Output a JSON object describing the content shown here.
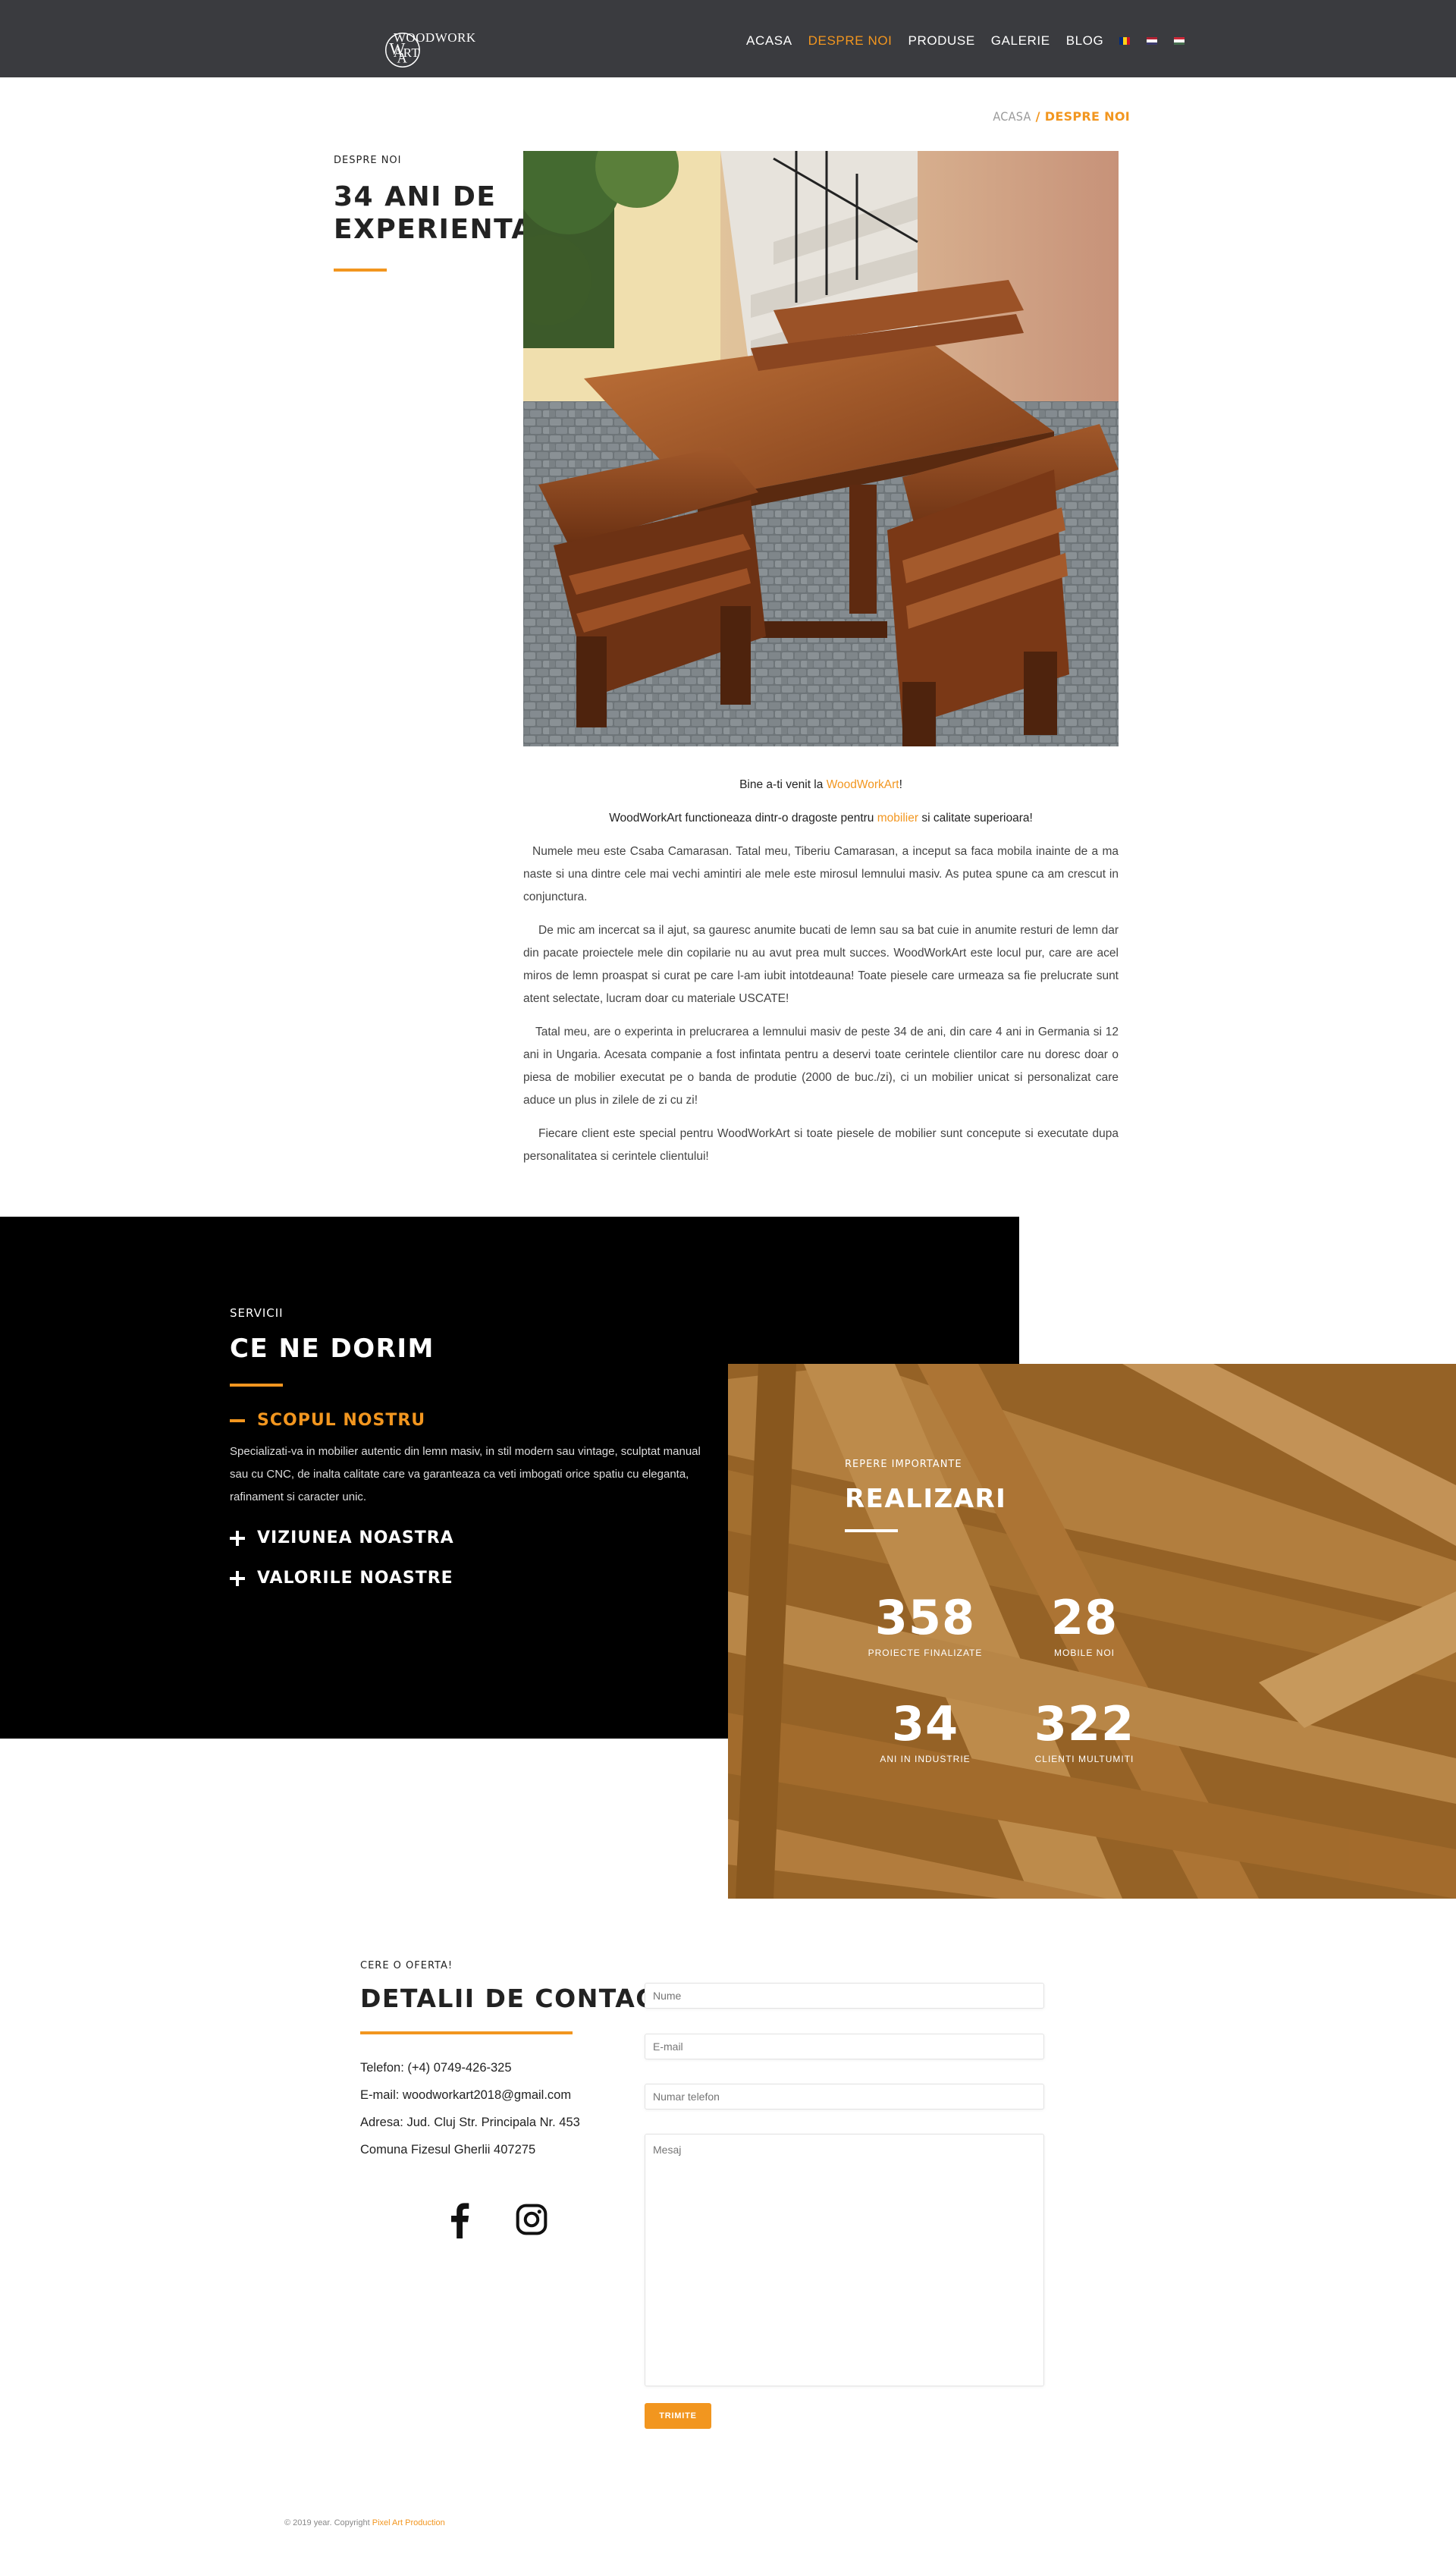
{
  "header": {
    "logo_text": "WOODWORK ART",
    "nav": [
      {
        "label": "ACASA",
        "active": false
      },
      {
        "label": "DESPRE NOI",
        "active": true
      },
      {
        "label": "PRODUSE",
        "active": false
      },
      {
        "label": "GALERIE",
        "active": false
      },
      {
        "label": "BLOG",
        "active": false
      }
    ],
    "languages": [
      "ro-flag",
      "en-flag",
      "hu-flag"
    ]
  },
  "breadcrumb": {
    "home": "ACASA",
    "separator": "/",
    "current": "DESPRE NOI"
  },
  "about": {
    "eyebrow": "DESPRE NOI",
    "title": "34 ANI DE EXPERIENTA",
    "photo_icon": "wooden-table-bench-photo",
    "welcome_pre": "Bine a-ti venit la ",
    "welcome_brand": "WoodWorkArt",
    "welcome_post": "!",
    "tagline_pre": "WoodWorkArt functioneaza dintr-o dragoste pentru ",
    "tagline_link": "mobilier",
    "tagline_post": " si calitate superioara!",
    "paragraphs": [
      "Numele meu este Csaba Camarasan. Tatal meu, Tiberiu Camarasan, a inceput sa faca mobila inainte de a ma naste si una dintre cele mai vechi amintiri ale mele este mirosul lemnului masiv.  As putea spune ca am crescut in conjunctura.",
      "De mic am incercat sa il ajut, sa gauresc anumite bucati de lemn sau sa bat cuie in anumite resturi de lemn dar din pacate proiectele mele din copilarie nu au avut prea mult succes. WoodWorkArt este locul pur, care are acel miros de lemn proaspat si curat pe care l-am iubit intotdeauna! Toate piesele care urmeaza sa fie prelucrate sunt atent selectate, lucram doar cu materiale USCATE!",
      "Tatal meu, are o experinta in prelucrarea a lemnului masiv de peste 34 de ani, din care 4 ani in Germania si 12 ani in Ungaria. Acesata companie a fost infintata pentru a deservi toate cerintele clientilor care nu doresc doar o piesa de mobilier executat pe o banda de produtie (2000 de buc./zi), ci un mobilier unicat si personalizat care aduce un plus in zilele de zi cu zi!",
      "Fiecare client este special pentru WoodWorkArt si toate piesele de mobilier sunt concepute si executate dupa personalitatea si cerintele clientului!"
    ]
  },
  "services": {
    "eyebrow": "SERVICII",
    "title": "CE NE DORIM",
    "items": [
      {
        "label": "SCOPUL NOSTRU",
        "open": true,
        "body": "Specializati-va in mobilier autentic din lemn masiv, in stil modern sau vintage, sculptat manual sau cu CNC, de inalta calitate care va garanteaza ca veti imbogati orice spatiu cu eleganta, rafinament si caracter unic."
      },
      {
        "label": "VIZIUNEA NOASTRA",
        "open": false
      },
      {
        "label": "VALORILE NOASTRE",
        "open": false
      }
    ]
  },
  "stats": {
    "eyebrow": "REPERE IMPORTANTE",
    "title": "REALIZARI",
    "items": [
      {
        "value": "358",
        "label": "PROIECTE FINALIZATE"
      },
      {
        "value": "28",
        "label": "MOBILE NOI"
      },
      {
        "value": "34",
        "label": "ANI IN INDUSTRIE"
      },
      {
        "value": "322",
        "label": "CLIENTI MULTUMITI"
      }
    ]
  },
  "contact": {
    "eyebrow": "CERE O OFERTA!",
    "title": "DETALII DE CONTACT",
    "phone": "Telefon: (+4) 0749-426-325",
    "email": "E-mail: woodworkart2018@gmail.com",
    "address": "Adresa: Jud. Cluj Str. Principala Nr. 453",
    "commune": "Comuna Fizesul Gherlii 407275",
    "social": [
      "facebook-icon",
      "instagram-icon"
    ],
    "form": {
      "name_placeholder": "Nume",
      "email_placeholder": "E-mail",
      "phone_placeholder": "Numar telefon",
      "message_placeholder": "Mesaj",
      "submit_label": "TRIMITE"
    }
  },
  "footer": {
    "text": "© 2019 year. Copyright ",
    "link": "Pixel Art Production"
  },
  "colors": {
    "accent": "#f2961f",
    "header_bg": "#3a3b3f",
    "services_bg": "#000000",
    "stats_bg": "#b07a34"
  }
}
